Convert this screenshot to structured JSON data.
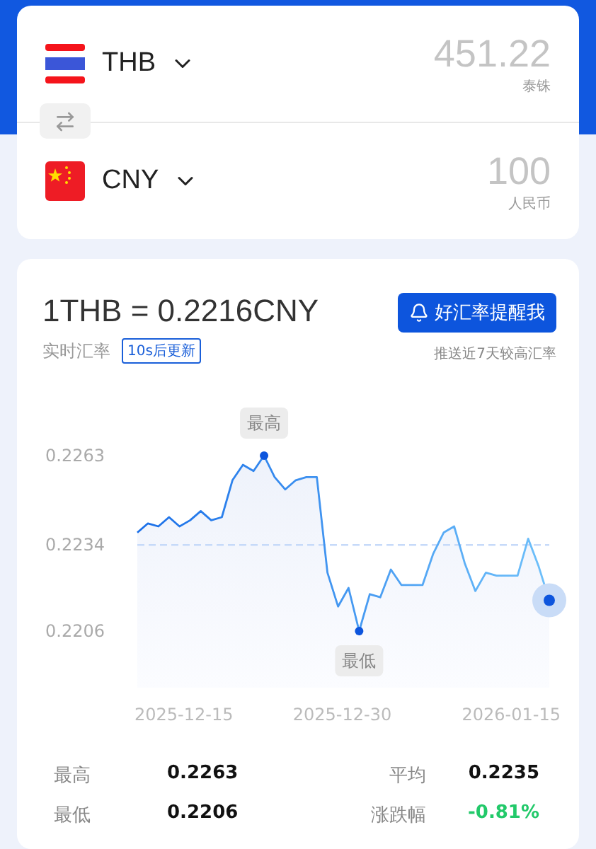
{
  "converter": {
    "from": {
      "code": "THB",
      "kind": "thailand",
      "placeholder": "451.22",
      "name": "泰铢"
    },
    "to": {
      "code": "CNY",
      "kind": "china",
      "placeholder": "100",
      "name": "人民币"
    }
  },
  "rate": {
    "title": "1THB = 0.2216CNY",
    "label": "实时汇率",
    "refresh": "10s后更新",
    "alert_button": "好汇率提醒我",
    "alert_hint": "推送近7天较高汇率"
  },
  "chart": {
    "chart_data": {
      "type": "area",
      "categories": [
        null,
        null,
        null,
        null,
        "2025-12-15",
        null,
        null,
        null,
        null,
        null,
        null,
        null,
        null,
        null,
        null,
        null,
        null,
        null,
        null,
        "2025-12-30",
        null,
        null,
        null,
        null,
        null,
        null,
        null,
        null,
        null,
        null,
        null,
        null,
        null,
        null,
        null,
        "2026-01-15",
        null,
        null,
        null,
        null
      ],
      "series": [
        {
          "color": "#1a6fe8",
          "values": [
            0.2238,
            0.2241,
            0.224,
            0.2243,
            0.224,
            0.2242,
            0.2245,
            0.2242,
            0.2243,
            0.2255,
            0.226,
            0.2258,
            0.2263,
            0.2256,
            0.2252,
            0.2255,
            0.2256,
            0.2256,
            0.2225,
            0.2214,
            0.222,
            0.2206,
            0.2218,
            0.2217,
            0.2226,
            0.2221,
            0.2221,
            0.2221,
            0.2231,
            0.2238,
            0.224,
            0.2228,
            0.2219,
            0.2225,
            0.2224,
            0.2224,
            0.2224,
            0.2236,
            0.2227,
            0.2216
          ]
        }
      ],
      "ylim": [
        0.2206,
        0.2263
      ],
      "ref_lines": [
        {
          "value": 0.2234,
          "axis": "y"
        }
      ],
      "yticks": [
        0.2263,
        0.2234,
        0.2206
      ],
      "annotations": [
        {
          "y": 0.2263,
          "text": "最高"
        },
        {
          "y": 0.2206,
          "text": "最低"
        }
      ]
    }
  },
  "stats": [
    {
      "label": "最高",
      "value": "0.2263",
      "kind": "plain"
    },
    {
      "label": "平均",
      "value": "0.2235",
      "kind": "plain"
    },
    {
      "label": "最低",
      "value": "0.2206",
      "kind": "plain"
    },
    {
      "label": "涨跌幅",
      "value": "-0.81%",
      "kind": "change",
      "color": "#22c96a"
    }
  ]
}
